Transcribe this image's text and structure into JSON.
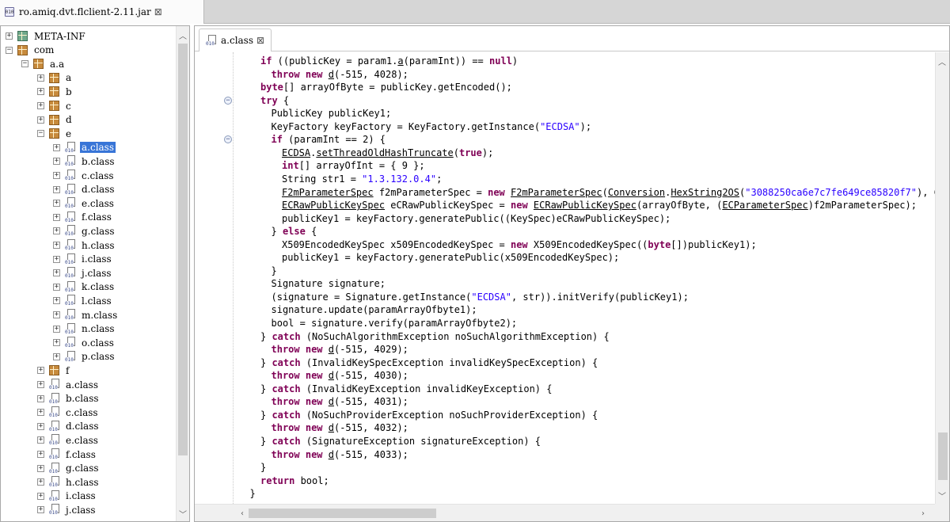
{
  "window": {
    "jar_tab_icon": "jar-icon",
    "jar_tab_label": "ro.amiq.dvt.flclient-2.11.jar",
    "close_glyph": "⊠"
  },
  "tree": {
    "items": [
      {
        "label": "META-INF",
        "kind": "package-meta",
        "level": 0,
        "expander": "+"
      },
      {
        "label": "com",
        "kind": "package",
        "level": 0,
        "expander": "−"
      },
      {
        "label": "a.a",
        "kind": "package",
        "level": 1,
        "expander": "−"
      },
      {
        "label": "a",
        "kind": "package",
        "level": 2,
        "expander": "+"
      },
      {
        "label": "b",
        "kind": "package",
        "level": 2,
        "expander": "+"
      },
      {
        "label": "c",
        "kind": "package",
        "level": 2,
        "expander": "+"
      },
      {
        "label": "d",
        "kind": "package",
        "level": 2,
        "expander": "+"
      },
      {
        "label": "e",
        "kind": "package",
        "level": 2,
        "expander": "−"
      },
      {
        "label": "a.class",
        "kind": "class",
        "level": 3,
        "expander": "+",
        "selected": true
      },
      {
        "label": "b.class",
        "kind": "class",
        "level": 3,
        "expander": "+"
      },
      {
        "label": "c.class",
        "kind": "class",
        "level": 3,
        "expander": "+"
      },
      {
        "label": "d.class",
        "kind": "class",
        "level": 3,
        "expander": "+"
      },
      {
        "label": "e.class",
        "kind": "class",
        "level": 3,
        "expander": "+"
      },
      {
        "label": "f.class",
        "kind": "class",
        "level": 3,
        "expander": "+"
      },
      {
        "label": "g.class",
        "kind": "class",
        "level": 3,
        "expander": "+"
      },
      {
        "label": "h.class",
        "kind": "class",
        "level": 3,
        "expander": "+"
      },
      {
        "label": "i.class",
        "kind": "class",
        "level": 3,
        "expander": "+"
      },
      {
        "label": "j.class",
        "kind": "class",
        "level": 3,
        "expander": "+"
      },
      {
        "label": "k.class",
        "kind": "class",
        "level": 3,
        "expander": "+"
      },
      {
        "label": "l.class",
        "kind": "class",
        "level": 3,
        "expander": "+"
      },
      {
        "label": "m.class",
        "kind": "class",
        "level": 3,
        "expander": "+"
      },
      {
        "label": "n.class",
        "kind": "class",
        "level": 3,
        "expander": "+"
      },
      {
        "label": "o.class",
        "kind": "class",
        "level": 3,
        "expander": "+"
      },
      {
        "label": "p.class",
        "kind": "class",
        "level": 3,
        "expander": "+"
      },
      {
        "label": "f",
        "kind": "package",
        "level": 2,
        "expander": "+"
      },
      {
        "label": "a.class",
        "kind": "class",
        "level": 2,
        "expander": "+"
      },
      {
        "label": "b.class",
        "kind": "class",
        "level": 2,
        "expander": "+"
      },
      {
        "label": "c.class",
        "kind": "class",
        "level": 2,
        "expander": "+"
      },
      {
        "label": "d.class",
        "kind": "class",
        "level": 2,
        "expander": "+"
      },
      {
        "label": "e.class",
        "kind": "class",
        "level": 2,
        "expander": "+"
      },
      {
        "label": "f.class",
        "kind": "class",
        "level": 2,
        "expander": "+"
      },
      {
        "label": "g.class",
        "kind": "class",
        "level": 2,
        "expander": "+"
      },
      {
        "label": "h.class",
        "kind": "class",
        "level": 2,
        "expander": "+"
      },
      {
        "label": "i.class",
        "kind": "class",
        "level": 2,
        "expander": "+"
      },
      {
        "label": "j.class",
        "kind": "class",
        "level": 2,
        "expander": "+"
      }
    ]
  },
  "editor": {
    "tab_label": "a.class",
    "tab_icon": "class-file-icon",
    "close_glyph": "⊠",
    "code_lines": [
      {
        "indent": 0,
        "tokens": [
          [
            "kw",
            "if"
          ],
          [
            "t",
            " ((publicKey = param1."
          ],
          [
            "u",
            "a"
          ],
          [
            "t",
            "(paramInt)) == "
          ],
          [
            "kw",
            "null"
          ],
          [
            "t",
            ")"
          ]
        ]
      },
      {
        "indent": 1,
        "tokens": [
          [
            "kw",
            "throw new "
          ],
          [
            "u",
            "d"
          ],
          [
            "t",
            "(-515, 4028);"
          ]
        ]
      },
      {
        "indent": 0,
        "tokens": [
          [
            "kw",
            "byte"
          ],
          [
            "t",
            "[] arrayOfByte = publicKey.getEncoded();"
          ]
        ]
      },
      {
        "indent": 0,
        "fold": true,
        "tokens": [
          [
            "kw",
            "try"
          ],
          [
            "t",
            " {"
          ]
        ]
      },
      {
        "indent": 1,
        "tokens": [
          [
            "t",
            "PublicKey publicKey1;"
          ]
        ]
      },
      {
        "indent": 1,
        "tokens": [
          [
            "t",
            "KeyFactory keyFactory = KeyFactory.getInstance("
          ],
          [
            "s",
            "\"ECDSA\""
          ],
          [
            "t",
            ");"
          ]
        ]
      },
      {
        "indent": 1,
        "fold": true,
        "tokens": [
          [
            "kw",
            "if"
          ],
          [
            "t",
            " (paramInt == 2) {"
          ]
        ]
      },
      {
        "indent": 2,
        "tokens": [
          [
            "u",
            "ECDSA"
          ],
          [
            "t",
            "."
          ],
          [
            "u",
            "setThreadOldHashTruncate"
          ],
          [
            "t",
            "("
          ],
          [
            "kw",
            "true"
          ],
          [
            "t",
            ");"
          ]
        ]
      },
      {
        "indent": 2,
        "tokens": [
          [
            "kw",
            "int"
          ],
          [
            "t",
            "[] arrayOfInt = { 9 };"
          ]
        ]
      },
      {
        "indent": 2,
        "tokens": [
          [
            "t",
            "String str1 = "
          ],
          [
            "s",
            "\"1.3.132.0.4\""
          ],
          [
            "t",
            ";"
          ]
        ]
      },
      {
        "indent": 2,
        "tokens": [
          [
            "u",
            "F2mParameterSpec"
          ],
          [
            "t",
            " f2mParameterSpec = "
          ],
          [
            "kw",
            "new "
          ],
          [
            "u",
            "F2mParameterSpec"
          ],
          [
            "t",
            "("
          ],
          [
            "u",
            "Conversion"
          ],
          [
            "t",
            "."
          ],
          [
            "u",
            "HexString2OS"
          ],
          [
            "t",
            "("
          ],
          [
            "s",
            "\"3088250ca6e7c7fe649ce85820f7\""
          ],
          [
            "t",
            "), Conv"
          ]
        ]
      },
      {
        "indent": 2,
        "tokens": [
          [
            "u",
            "ECRawPublicKeySpec"
          ],
          [
            "t",
            " eCRawPublicKeySpec = "
          ],
          [
            "kw",
            "new "
          ],
          [
            "u",
            "ECRawPublicKeySpec"
          ],
          [
            "t",
            "(arrayOfByte, ("
          ],
          [
            "u",
            "ECParameterSpec"
          ],
          [
            "t",
            ")f2mParameterSpec);"
          ]
        ]
      },
      {
        "indent": 2,
        "tokens": [
          [
            "t",
            "publicKey1 = keyFactory.generatePublic((KeySpec)eCRawPublicKeySpec);"
          ]
        ]
      },
      {
        "indent": 1,
        "tokens": [
          [
            "t",
            "} "
          ],
          [
            "kw",
            "else"
          ],
          [
            "t",
            " {"
          ]
        ]
      },
      {
        "indent": 2,
        "tokens": [
          [
            "t",
            "X509EncodedKeySpec x509EncodedKeySpec = "
          ],
          [
            "kw",
            "new"
          ],
          [
            "t",
            " X509EncodedKeySpec(("
          ],
          [
            "kw",
            "byte"
          ],
          [
            "t",
            "[])publicKey1);"
          ]
        ]
      },
      {
        "indent": 2,
        "tokens": [
          [
            "t",
            "publicKey1 = keyFactory.generatePublic(x509EncodedKeySpec);"
          ]
        ]
      },
      {
        "indent": 1,
        "tokens": [
          [
            "t",
            "}"
          ]
        ]
      },
      {
        "indent": 1,
        "tokens": [
          [
            "t",
            "Signature signature;"
          ]
        ]
      },
      {
        "indent": 1,
        "tokens": [
          [
            "t",
            "(signature = Signature.getInstance("
          ],
          [
            "s",
            "\"ECDSA\""
          ],
          [
            "t",
            ", str)).initVerify(publicKey1);"
          ]
        ]
      },
      {
        "indent": 1,
        "tokens": [
          [
            "t",
            "signature.update(paramArrayOfbyte1);"
          ]
        ]
      },
      {
        "indent": 1,
        "tokens": [
          [
            "t",
            "bool = signature.verify(paramArrayOfbyte2);"
          ]
        ]
      },
      {
        "indent": 0,
        "tokens": [
          [
            "t",
            "} "
          ],
          [
            "kw",
            "catch"
          ],
          [
            "t",
            " (NoSuchAlgorithmException noSuchAlgorithmException) {"
          ]
        ]
      },
      {
        "indent": 1,
        "tokens": [
          [
            "kw",
            "throw new "
          ],
          [
            "u",
            "d"
          ],
          [
            "t",
            "(-515, 4029);"
          ]
        ]
      },
      {
        "indent": 0,
        "tokens": [
          [
            "t",
            "} "
          ],
          [
            "kw",
            "catch"
          ],
          [
            "t",
            " (InvalidKeySpecException invalidKeySpecException) {"
          ]
        ]
      },
      {
        "indent": 1,
        "tokens": [
          [
            "kw",
            "throw new "
          ],
          [
            "u",
            "d"
          ],
          [
            "t",
            "(-515, 4030);"
          ]
        ]
      },
      {
        "indent": 0,
        "tokens": [
          [
            "t",
            "} "
          ],
          [
            "kw",
            "catch"
          ],
          [
            "t",
            " (InvalidKeyException invalidKeyException) {"
          ]
        ]
      },
      {
        "indent": 1,
        "tokens": [
          [
            "kw",
            "throw new "
          ],
          [
            "u",
            "d"
          ],
          [
            "t",
            "(-515, 4031);"
          ]
        ]
      },
      {
        "indent": 0,
        "tokens": [
          [
            "t",
            "} "
          ],
          [
            "kw",
            "catch"
          ],
          [
            "t",
            " (NoSuchProviderException noSuchProviderException) {"
          ]
        ]
      },
      {
        "indent": 1,
        "tokens": [
          [
            "kw",
            "throw new "
          ],
          [
            "u",
            "d"
          ],
          [
            "t",
            "(-515, 4032);"
          ]
        ]
      },
      {
        "indent": 0,
        "tokens": [
          [
            "t",
            "} "
          ],
          [
            "kw",
            "catch"
          ],
          [
            "t",
            " (SignatureException signatureException) {"
          ]
        ]
      },
      {
        "indent": 1,
        "tokens": [
          [
            "kw",
            "throw new "
          ],
          [
            "u",
            "d"
          ],
          [
            "t",
            "(-515, 4033);"
          ]
        ]
      },
      {
        "indent": 0,
        "tokens": [
          [
            "t",
            "}"
          ]
        ]
      },
      {
        "indent": 0,
        "tokens": [
          [
            "kw",
            "return"
          ],
          [
            "t",
            " bool;"
          ]
        ]
      },
      {
        "indent": -1,
        "tokens": [
          [
            "t",
            "}"
          ]
        ]
      }
    ]
  },
  "colors": {
    "keyword": "#7f0055",
    "string": "#2a00ff",
    "selection": "#3875d7"
  }
}
